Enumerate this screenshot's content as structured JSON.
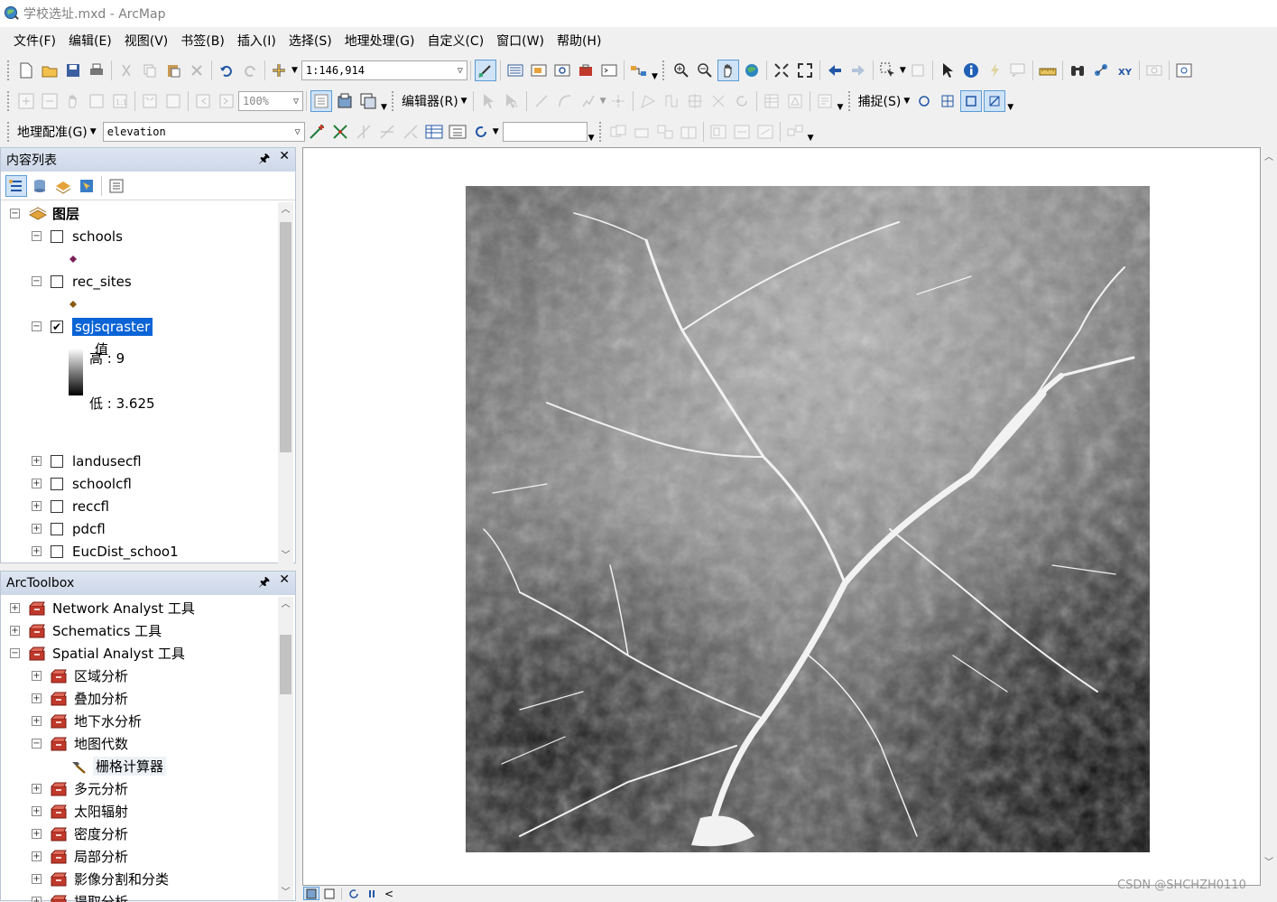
{
  "window": {
    "title": "学校选址.mxd - ArcMap"
  },
  "menu": [
    "文件(F)",
    "编辑(E)",
    "视图(V)",
    "书签(B)",
    "插入(I)",
    "选择(S)",
    "地理处理(G)",
    "自定义(C)",
    "窗口(W)",
    "帮助(H)"
  ],
  "toolbar1": {
    "scale_value": "1:146,914"
  },
  "toolbar2": {
    "zoom_value": "100%",
    "editor_label": "编辑器(R)",
    "snapping_label": "捕捉(S)"
  },
  "toolbar3": {
    "georef_label": "地理配准(G)",
    "layer_value": "elevation",
    "input_value": ""
  },
  "toc": {
    "title": "内容列表",
    "root_label": "图层",
    "layers": [
      {
        "name": "schools",
        "checked": false,
        "expanded": true
      },
      {
        "name": "rec_sites",
        "checked": false,
        "expanded": true
      },
      {
        "name": "sgjsqraster",
        "checked": true,
        "expanded": true,
        "selected": true
      },
      {
        "name": "landusecfl",
        "checked": false,
        "expanded": false
      },
      {
        "name": "schoolcfl",
        "checked": false,
        "expanded": false
      },
      {
        "name": "reccfl",
        "checked": false,
        "expanded": false
      },
      {
        "name": "pdcfl",
        "checked": false,
        "expanded": false
      },
      {
        "name": "EucDist_schoo1",
        "checked": false,
        "expanded": false
      }
    ],
    "legend": {
      "field_label": "值",
      "high_label": "高 : 9",
      "low_label": "低 : 3.625"
    },
    "symbol_colors": {
      "schools": "#7a1f5a",
      "rec_sites": "#8a5a10"
    }
  },
  "toolbox": {
    "title": "ArcToolbox",
    "items": [
      {
        "label": "Network Analyst 工具",
        "level": 0,
        "expanded": false
      },
      {
        "label": "Schematics 工具",
        "level": 0,
        "expanded": false
      },
      {
        "label": "Spatial Analyst 工具",
        "level": 0,
        "expanded": true
      },
      {
        "label": "区域分析",
        "level": 1,
        "expanded": false
      },
      {
        "label": "叠加分析",
        "level": 1,
        "expanded": false
      },
      {
        "label": "地下水分析",
        "level": 1,
        "expanded": false
      },
      {
        "label": "地图代数",
        "level": 1,
        "expanded": true
      },
      {
        "label": "栅格计算器",
        "level": 2,
        "tool": true
      },
      {
        "label": "多元分析",
        "level": 1,
        "expanded": false
      },
      {
        "label": "太阳辐射",
        "level": 1,
        "expanded": false
      },
      {
        "label": "密度分析",
        "level": 1,
        "expanded": false
      },
      {
        "label": "局部分析",
        "level": 1,
        "expanded": false
      },
      {
        "label": "影像分割和分类",
        "level": 1,
        "expanded": false
      },
      {
        "label": "提取分析",
        "level": 1,
        "expanded": false
      }
    ]
  },
  "watermark": "CSDN @SHCHZH0110"
}
